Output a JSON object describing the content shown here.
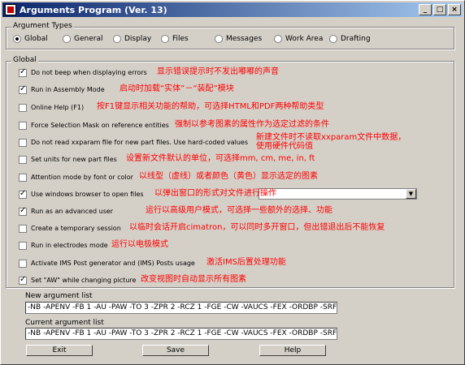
{
  "window": {
    "title": "Arguments Program (Ver. 13)",
    "controls": [
      "_",
      "□",
      "×"
    ]
  },
  "argument_types": {
    "label": "Argument Types",
    "options": [
      {
        "label": "Global",
        "selected": true
      },
      {
        "label": "General",
        "selected": false
      },
      {
        "label": "Display",
        "selected": false
      },
      {
        "label": "Files",
        "selected": false
      },
      {
        "label": "Messages",
        "selected": false
      },
      {
        "label": "Work Area",
        "selected": false
      },
      {
        "label": "Drafting",
        "selected": false
      }
    ]
  },
  "global": {
    "label": "Global",
    "options": [
      {
        "label": "Do not beep when displaying errors",
        "checked": true,
        "note": "显示错误提示时不发出嘟嘟的声音"
      },
      {
        "label": "Run in Assembly Mode",
        "checked": true,
        "note": "启动时加载“实体”－“装配”模块"
      },
      {
        "label": "Online Help (F1)",
        "checked": false,
        "note": "按F1键显示相关功能的帮助，可选择HTML和PDF两种帮助类型"
      },
      {
        "label": "Force Selection Mask on reference entities",
        "checked": false,
        "note": "强制以参考图素的属性作为选定过滤的条件"
      },
      {
        "label": "Do not read xxparam file for new part files. Use hard-coded values",
        "checked": false,
        "note": "新建文件时不读取xxparam文件中数据，",
        "note2": "使用硬件代码值"
      },
      {
        "label": "Set units for new part files",
        "checked": false,
        "note": "设置新文件默认的单位，可选择mm, cm, me, in, ft"
      },
      {
        "label": "Attention mode by font or color",
        "checked": false,
        "note": "以线型（虚线）或者颜色（黄色）显示选定的图素"
      },
      {
        "label": "Use windows browser to open files",
        "checked": true,
        "note": "以弹出窗口的形式对文件进行操作"
      },
      {
        "label": "Run as an advanced user",
        "checked": true,
        "note": "运行以高级用户模式，可选择一些额外的选择、功能"
      },
      {
        "label": "Create a temporary session",
        "checked": false,
        "note": "以临时会话开启cimatron，可以同时多开窗口，但出错退出后不能恢复"
      },
      {
        "label": "Run in electrodes mode",
        "checked": false,
        "note": "运行以电极模式"
      },
      {
        "label": "Activate IMS Post generator and (IMS) Posts usage",
        "checked": false,
        "note": "激活IMS后置处理功能"
      },
      {
        "label": "Set \"AW\" while changing picture",
        "checked": true,
        "note": "改变视图时自动显示所有图素"
      }
    ],
    "browser_dropdown_value": ""
  },
  "new_argument_list": {
    "label": "New argument list",
    "value": "-NB -APENV -FB 1 -AU -PAW -TO 3 -ZPR 2 -RCZ 1 -FGE -CW -VAUCS -FEX -ORDBP -SRF"
  },
  "current_argument_list": {
    "label": "Current argument list",
    "value": "-NB -APENV -FB 1 -AU -PAW -TO 3 -ZPR 2 -RCZ 1 -FGE -CW -VAUCS -FEX -ORDBP -SRFHDL"
  },
  "buttons": {
    "exit": "Exit",
    "save": "Save",
    "help": "Help"
  }
}
